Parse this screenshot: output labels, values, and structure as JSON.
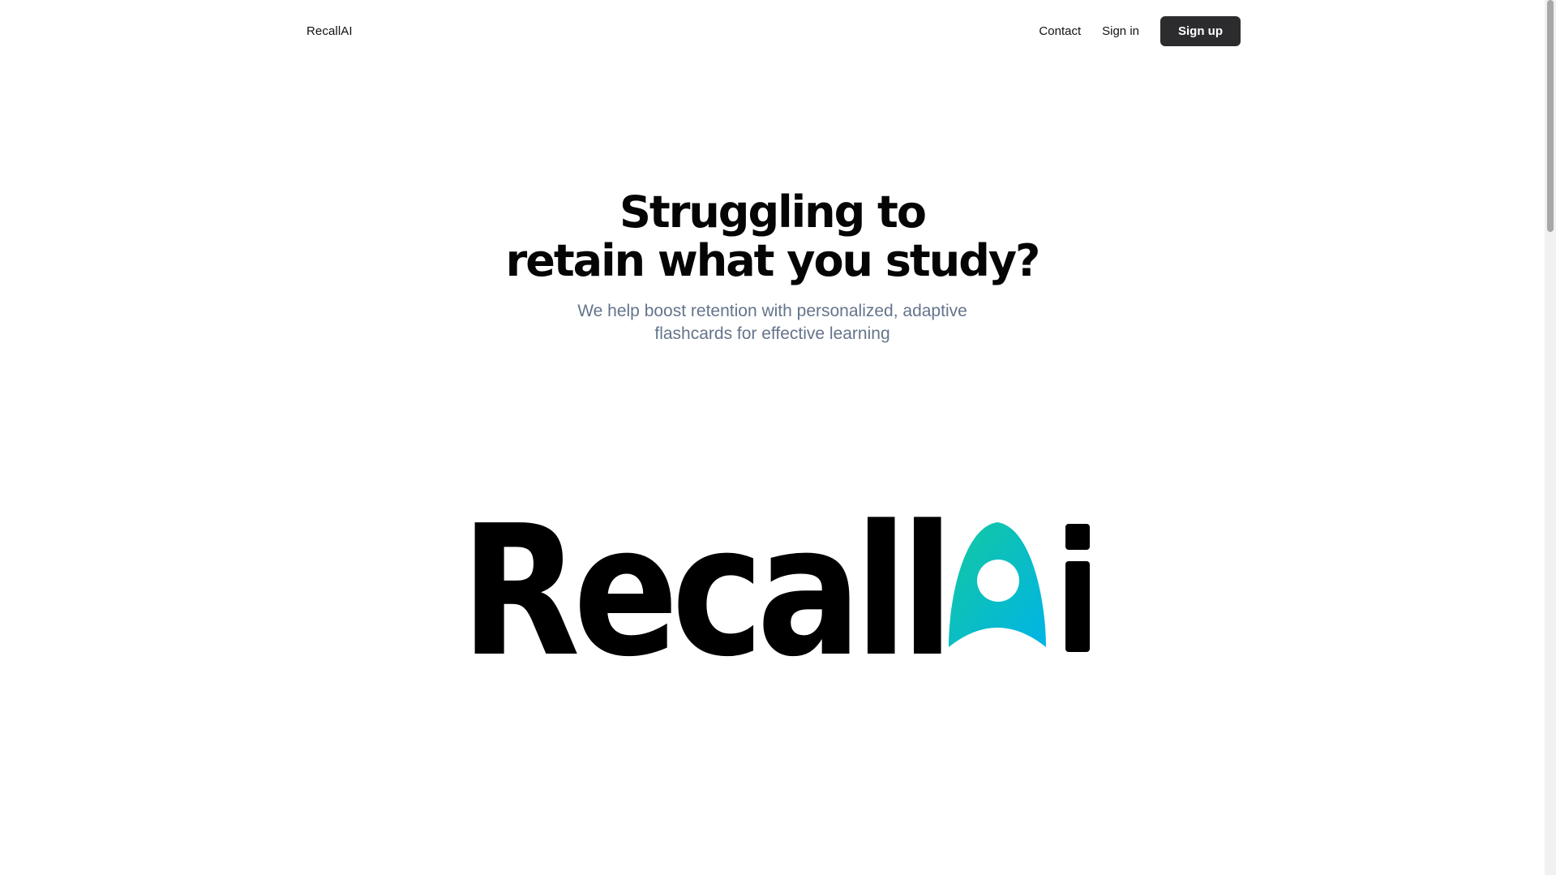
{
  "header": {
    "brand": "RecallAI",
    "nav": {
      "contact": "Contact",
      "sign_in": "Sign in",
      "sign_up": "Sign up"
    }
  },
  "hero": {
    "title_line1": "Struggling to",
    "title_line2": "retain what you study?",
    "subtitle_line1": "We help boost retention with personalized, adaptive",
    "subtitle_line2": "flashcards for effective learning"
  },
  "logo": {
    "text": "RecallAi",
    "accent_gradient": [
      "#14c8a0",
      "#00b4e6"
    ],
    "color": "#000000"
  },
  "colors": {
    "button_bg": "#2c2c2e",
    "subtitle": "#64748b"
  }
}
